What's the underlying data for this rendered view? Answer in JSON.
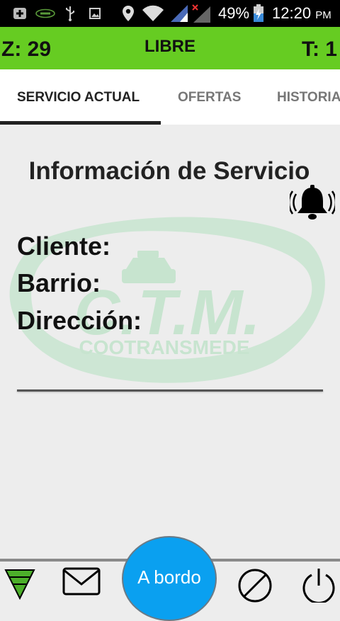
{
  "status_bar": {
    "battery": "49%",
    "time": "12:20",
    "ampm": "PM",
    "icons": [
      "plus-box-icon",
      "app-logo-icon",
      "usb-icon",
      "image-icon",
      "location-icon",
      "wifi-icon",
      "signal-icon",
      "signal-off-icon",
      "battery-charging-icon"
    ]
  },
  "header": {
    "zone": "Z: 29",
    "state": "LIBRE",
    "turn": "T: 1",
    "bg_color": "#66cc22"
  },
  "tabs": [
    {
      "label": "SERVICIO ACTUAL",
      "active": true
    },
    {
      "label": "OFERTAS",
      "active": false
    },
    {
      "label": "HISTORIAL",
      "active": false
    }
  ],
  "service": {
    "title": "Información de Servicio",
    "client_label": "Cliente:",
    "barrio_label": "Barrio:",
    "address_label": "Dirección:"
  },
  "logo": {
    "initials": "C.T.M.",
    "name": "COOTRANSMEDE"
  },
  "bottom_bar": {
    "aboard_label": "A bordo",
    "accent_color": "#0aa0f0",
    "icons": [
      "filter-triangle-icon",
      "envelope-icon",
      "cancel-icon",
      "power-icon"
    ]
  }
}
